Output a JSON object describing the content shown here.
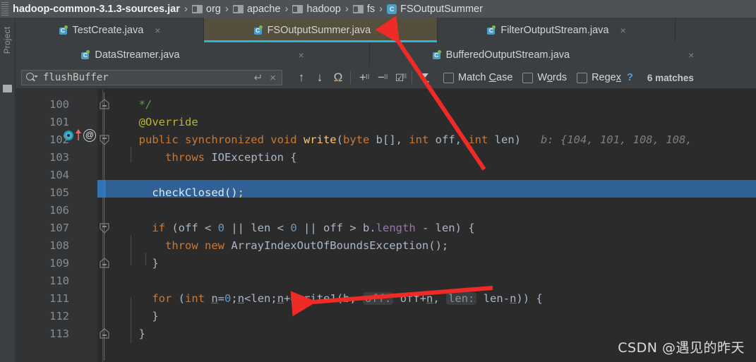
{
  "breadcrumb": {
    "items": [
      {
        "label": "hadoop-common-3.1.3-sources.jar",
        "icon": "jar-icon"
      },
      {
        "label": "org",
        "icon": "folder-icon"
      },
      {
        "label": "apache",
        "icon": "folder-icon"
      },
      {
        "label": "hadoop",
        "icon": "folder-icon"
      },
      {
        "label": "fs",
        "icon": "folder-icon"
      },
      {
        "label": "FSOutputSummer",
        "icon": "class-icon"
      }
    ],
    "separator": "›"
  },
  "left_strip": {
    "label": "Project"
  },
  "tabs": {
    "row1": [
      {
        "label": "TestCreate.java",
        "icon": "java-class-icon",
        "active": false,
        "close": "×"
      },
      {
        "label": "FSOutputSummer.java",
        "icon": "java-class-icon",
        "active": true,
        "close": "×"
      },
      {
        "label": "FilterOutputStream.java",
        "icon": "java-class-icon",
        "active": false,
        "close": "×"
      }
    ],
    "row2": [
      {
        "label": "DataStreamer.java",
        "icon": "java-class-icon",
        "active": false,
        "close": "×"
      },
      {
        "label": "BufferedOutputStream.java",
        "icon": "java-class-icon",
        "active": false,
        "close": "×"
      }
    ]
  },
  "findbar": {
    "search_value": "flushBuffer",
    "search_placeholder": "Search",
    "enter_icon": "↵",
    "clear_icon": "×",
    "buttons": [
      {
        "name": "find-previous",
        "glyph": "↑"
      },
      {
        "name": "find-next",
        "glyph": "↓"
      },
      {
        "name": "find-all",
        "glyph": "Ω"
      },
      {
        "name": "add-line",
        "glyph": "+"
      },
      {
        "name": "remove-line",
        "glyph": "−"
      },
      {
        "name": "select-all-occurrences",
        "glyph": "☑"
      },
      {
        "name": "filter",
        "glyph": "▼"
      }
    ],
    "options": [
      {
        "label_pre": "Match ",
        "label_mnemonic": "C",
        "label_post": "ase",
        "checked": false
      },
      {
        "label_pre": "W",
        "label_mnemonic": "o",
        "label_post": "rds",
        "checked": false
      },
      {
        "label_pre": "Rege",
        "label_mnemonic": "x",
        "label_post": "",
        "checked": false
      }
    ],
    "help_glyph": "?",
    "match_count": "6 matches"
  },
  "editor": {
    "first_line_number": 100,
    "selected_line": 105,
    "line_numbers": [
      100,
      101,
      102,
      103,
      104,
      105,
      106,
      107,
      108,
      109,
      110,
      111,
      112,
      113
    ],
    "gutter_markers": {
      "run_marker_line": 102,
      "override_arrow_line": 102,
      "annotation_badge_line": 102,
      "annotation_badge_glyph": "@"
    },
    "lines": [
      {
        "num": 100,
        "text": "  */"
      },
      {
        "num": 101,
        "text": "  @Override"
      },
      {
        "num": 102,
        "text": "  public synchronized void write(byte b[], int off, int len)"
      },
      {
        "num": 102,
        "hint": "b: {104, 101, 108, 108,"
      },
      {
        "num": 103,
        "text": "      throws IOException {"
      },
      {
        "num": 104,
        "text": ""
      },
      {
        "num": 105,
        "text": "    checkClosed();"
      },
      {
        "num": 106,
        "text": ""
      },
      {
        "num": 107,
        "text": "    if (off < 0 || len < 0 || off > b.length - len) {"
      },
      {
        "num": 108,
        "text": "      throw new ArrayIndexOutOfBoundsException();"
      },
      {
        "num": 109,
        "text": "    }"
      },
      {
        "num": 110,
        "text": ""
      },
      {
        "num": 111,
        "text": "    for (int n=0;n<len;n+=write1(b, off: off+n, len: len-n)) {"
      },
      {
        "num": 112,
        "text": "    }"
      },
      {
        "num": 113,
        "text": "  }"
      }
    ],
    "inlay_hints": [
      {
        "label": "b:",
        "value": "{104, 101, 108, 108,"
      },
      {
        "label": "off:",
        "value": "off+n"
      },
      {
        "label": "len:",
        "value": "len-n"
      }
    ]
  },
  "watermark": "CSDN @遇见的昨天",
  "colors": {
    "accent_tab_underline": "#29b5d4",
    "selection": "#2f6196",
    "keyword": "#cc7832",
    "annotation": "#bbb529",
    "comment": "#629755",
    "number": "#6897bb",
    "field": "#9876aa",
    "method": "#ffc66d",
    "editor_bg": "#2b2b2b",
    "chrome_bg": "#3c3f41",
    "arrow_color": "#ee2b26"
  }
}
